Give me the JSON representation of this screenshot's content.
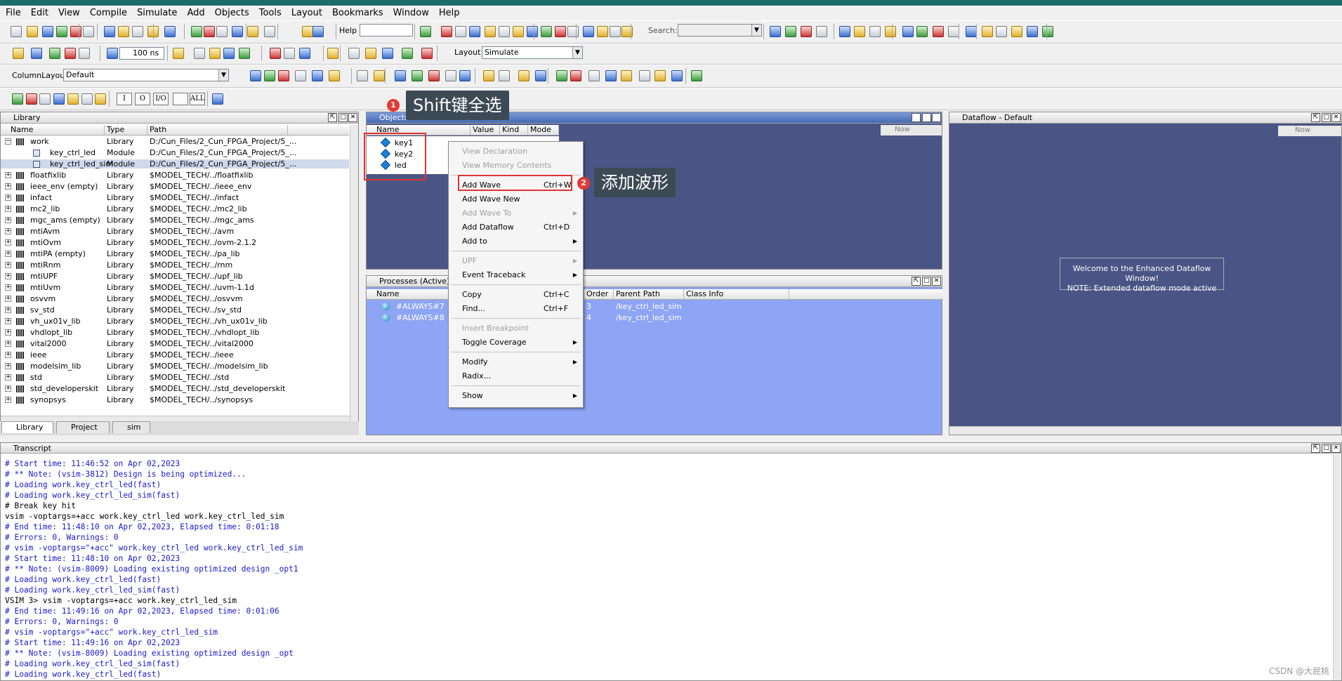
{
  "menu": [
    "File",
    "Edit",
    "View",
    "Compile",
    "Simulate",
    "Add",
    "Objects",
    "Tools",
    "Layout",
    "Bookmarks",
    "Window",
    "Help"
  ],
  "toolbar": {
    "help_label": "Help",
    "search_label": "Search:",
    "run_length": "100 ns",
    "layout_label": "Layout",
    "layout_value": "Simulate",
    "column_layout_label": "ColumnLayout",
    "column_layout_value": "Default",
    "filter_buttons": [
      "I",
      "O",
      "I/O",
      "",
      "ALL"
    ]
  },
  "library": {
    "title": "Library",
    "columns": [
      "Name",
      "Type",
      "Path"
    ],
    "rows": [
      {
        "name": "work",
        "type": "Library",
        "path": "D:/Cun_Files/2_Cun_FPGA_Project/5_...",
        "level": 0,
        "expanded": true
      },
      {
        "name": "key_ctrl_led",
        "type": "Module",
        "path": "D:/Cun_Files/2_Cun_FPGA_Project/5_...",
        "level": 1
      },
      {
        "name": "key_ctrl_led_sim",
        "type": "Module",
        "path": "D:/Cun_Files/2_Cun_FPGA_Project/5_...",
        "level": 1,
        "selected": true
      },
      {
        "name": "floatfixlib",
        "type": "Library",
        "path": "$MODEL_TECH/../floatfixlib",
        "level": 0
      },
      {
        "name": "ieee_env  (empty)",
        "type": "Library",
        "path": "$MODEL_TECH/../ieee_env",
        "level": 0
      },
      {
        "name": "infact",
        "type": "Library",
        "path": "$MODEL_TECH/../infact",
        "level": 0
      },
      {
        "name": "mc2_lib",
        "type": "Library",
        "path": "$MODEL_TECH/../mc2_lib",
        "level": 0
      },
      {
        "name": "mgc_ams  (empty)",
        "type": "Library",
        "path": "$MODEL_TECH/../mgc_ams",
        "level": 0
      },
      {
        "name": "mtiAvm",
        "type": "Library",
        "path": "$MODEL_TECH/../avm",
        "level": 0
      },
      {
        "name": "mtiOvm",
        "type": "Library",
        "path": "$MODEL_TECH/../ovm-2.1.2",
        "level": 0
      },
      {
        "name": "mtiPA  (empty)",
        "type": "Library",
        "path": "$MODEL_TECH/../pa_lib",
        "level": 0
      },
      {
        "name": "mtiRnm",
        "type": "Library",
        "path": "$MODEL_TECH/../rnm",
        "level": 0
      },
      {
        "name": "mtiUPF",
        "type": "Library",
        "path": "$MODEL_TECH/../upf_lib",
        "level": 0
      },
      {
        "name": "mtiUvm",
        "type": "Library",
        "path": "$MODEL_TECH/../uvm-1.1d",
        "level": 0
      },
      {
        "name": "osvvm",
        "type": "Library",
        "path": "$MODEL_TECH/../osvvm",
        "level": 0
      },
      {
        "name": "sv_std",
        "type": "Library",
        "path": "$MODEL_TECH/../sv_std",
        "level": 0
      },
      {
        "name": "vh_ux01v_lib",
        "type": "Library",
        "path": "$MODEL_TECH/../vh_ux01v_lib",
        "level": 0
      },
      {
        "name": "vhdlopt_lib",
        "type": "Library",
        "path": "$MODEL_TECH/../vhdlopt_lib",
        "level": 0
      },
      {
        "name": "vital2000",
        "type": "Library",
        "path": "$MODEL_TECH/../vital2000",
        "level": 0
      },
      {
        "name": "ieee",
        "type": "Library",
        "path": "$MODEL_TECH/../ieee",
        "level": 0
      },
      {
        "name": "modelsim_lib",
        "type": "Library",
        "path": "$MODEL_TECH/../modelsim_lib",
        "level": 0
      },
      {
        "name": "std",
        "type": "Library",
        "path": "$MODEL_TECH/../std",
        "level": 0
      },
      {
        "name": "std_developerskit",
        "type": "Library",
        "path": "$MODEL_TECH/../std_developerskit",
        "level": 0
      },
      {
        "name": "synopsys",
        "type": "Library",
        "path": "$MODEL_TECH/../synopsys",
        "level": 0
      }
    ],
    "tabs": [
      "Library",
      "Project",
      "sim"
    ]
  },
  "objects": {
    "title": "Objects",
    "columns": [
      "Name",
      "Value",
      "Kind",
      "Mode"
    ],
    "items": [
      "key1",
      "key2",
      "led"
    ],
    "now_label": "Now"
  },
  "processes": {
    "title": "Processes (Active)",
    "columns": [
      "Name",
      "Order",
      "Parent Path",
      "Class Info"
    ],
    "rows": [
      {
        "name": "#ALWAYS#7",
        "order": "3",
        "parent": "/key_ctrl_led_sim"
      },
      {
        "name": "#ALWAYS#8",
        "order": "4",
        "parent": "/key_ctrl_led_sim"
      }
    ]
  },
  "dataflow": {
    "title": "Dataflow - Default",
    "now_label": "Now",
    "welcome_line1": "Welcome to the Enhanced Dataflow Window!",
    "welcome_line2": "NOTE: Extended dataflow mode active"
  },
  "context_menu": {
    "items": [
      {
        "label": "View Declaration",
        "disabled": true
      },
      {
        "label": "View Memory Contents",
        "disabled": true
      },
      {
        "sep": true
      },
      {
        "label": "Add Wave",
        "shortcut": "Ctrl+W"
      },
      {
        "label": "Add Wave New"
      },
      {
        "label": "Add Wave To",
        "disabled": true,
        "sub": true
      },
      {
        "label": "Add Dataflow",
        "shortcut": "Ctrl+D"
      },
      {
        "label": "Add to",
        "sub": true
      },
      {
        "sep": true
      },
      {
        "label": "UPF",
        "disabled": true,
        "sub": true
      },
      {
        "label": "Event Traceback",
        "sub": true
      },
      {
        "sep": true
      },
      {
        "label": "Copy",
        "shortcut": "Ctrl+C"
      },
      {
        "label": "Find...",
        "shortcut": "Ctrl+F"
      },
      {
        "sep": true
      },
      {
        "label": "Insert Breakpoint",
        "disabled": true
      },
      {
        "label": "Toggle Coverage",
        "sub": true
      },
      {
        "sep": true
      },
      {
        "label": "Modify",
        "sub": true
      },
      {
        "label": "Radix..."
      },
      {
        "sep": true
      },
      {
        "label": "Show",
        "sub": true
      }
    ]
  },
  "annotations": {
    "step1_number": "1",
    "step1_text": "Shift键全选",
    "step2_number": "2",
    "step2_text": "添加波形"
  },
  "transcript": {
    "title": "Transcript",
    "lines": [
      {
        "text": "# Start time: 11:46:52 on Apr 02,2023",
        "c": "blue"
      },
      {
        "text": "# ** Note: (vsim-3812) Design is being optimized...",
        "c": "blue"
      },
      {
        "text": "# Loading work.key_ctrl_led(fast)",
        "c": "blue"
      },
      {
        "text": "# Loading work.key_ctrl_led_sim(fast)",
        "c": "blue"
      },
      {
        "text": "# Break key hit",
        "c": "black"
      },
      {
        "text": "vsim -voptargs=+acc work.key_ctrl_led work.key_ctrl_led_sim",
        "c": "black"
      },
      {
        "text": "# End time: 11:48:10 on Apr 02,2023, Elapsed time: 0:01:18",
        "c": "blue"
      },
      {
        "text": "# Errors: 0, Warnings: 0",
        "c": "blue"
      },
      {
        "text": "# vsim -voptargs=\"+acc\" work.key_ctrl_led work.key_ctrl_led_sim",
        "c": "blue"
      },
      {
        "text": "# Start time: 11:48:10 on Apr 02,2023",
        "c": "blue"
      },
      {
        "text": "# ** Note: (vsim-8009) Loading existing optimized design _opt1",
        "c": "blue"
      },
      {
        "text": "# Loading work.key_ctrl_led(fast)",
        "c": "blue"
      },
      {
        "text": "# Loading work.key_ctrl_led_sim(fast)",
        "c": "blue"
      },
      {
        "text": "VSIM 3> vsim -voptargs=+acc work.key_ctrl_led_sim",
        "c": "black"
      },
      {
        "text": "# End time: 11:49:16 on Apr 02,2023, Elapsed time: 0:01:06",
        "c": "blue"
      },
      {
        "text": "# Errors: 0, Warnings: 0",
        "c": "blue"
      },
      {
        "text": "# vsim -voptargs=\"+acc\" work.key_ctrl_led_sim",
        "c": "blue"
      },
      {
        "text": "# Start time: 11:49:16 on Apr 02,2023",
        "c": "blue"
      },
      {
        "text": "# ** Note: (vsim-8009) Loading existing optimized design _opt",
        "c": "blue"
      },
      {
        "text": "# Loading work.key_ctrl_led_sim(fast)",
        "c": "blue"
      },
      {
        "text": "# Loading work.key_ctrl_led(fast)",
        "c": "blue"
      }
    ]
  },
  "watermark": "CSDN @大屁桃",
  "colors": {
    "titlebar": "#1e6b6b",
    "panel_blue": "#4a5585",
    "process_blue": "#8ea4f4",
    "dataflow_bg": "#4a5585",
    "highlight_red": "#e03333",
    "transcript_blue": "#1a1acc"
  }
}
